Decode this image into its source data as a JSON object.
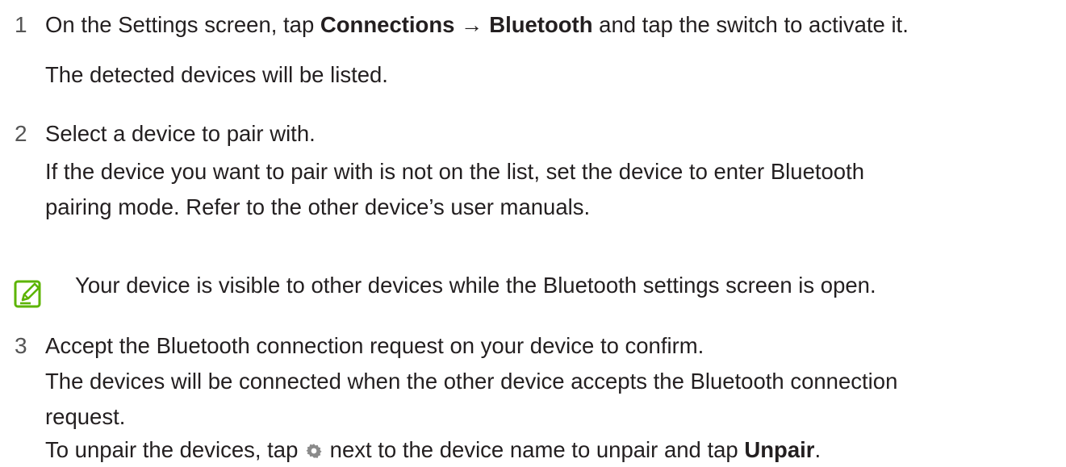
{
  "steps": [
    {
      "number": "1",
      "text_before": "On the Settings screen, tap ",
      "bold1": "Connections",
      "arrow": " → ",
      "bold2": "Bluetooth",
      "text_after": " and tap the switch to activate it.",
      "sub": "The detected devices will be listed."
    },
    {
      "number": "2",
      "text": "Select a device to pair with.",
      "sub_line1": "If the device you want to pair with is not on the list, set the device to enter Bluetooth",
      "sub_line2": "pairing mode. Refer to the other device’s user manuals."
    },
    {
      "number": "3",
      "text": "Accept the Bluetooth connection request on your device to confirm.",
      "sub_line1": "The devices will be connected when the other device accepts the Bluetooth connection",
      "sub_line2": "request.",
      "unpair_before": "To unpair the devices, tap ",
      "unpair_mid": " next to the device name to unpair and tap ",
      "unpair_bold": "Unpair",
      "unpair_end": "."
    }
  ],
  "note": {
    "icon": "note-pencil-icon",
    "text": "Your device is visible to other devices while the Bluetooth settings screen is open."
  },
  "colors": {
    "text": "#231f20",
    "step_number": "#555555",
    "note_icon": "#5cb400",
    "gear_icon": "#8a8a8a"
  }
}
